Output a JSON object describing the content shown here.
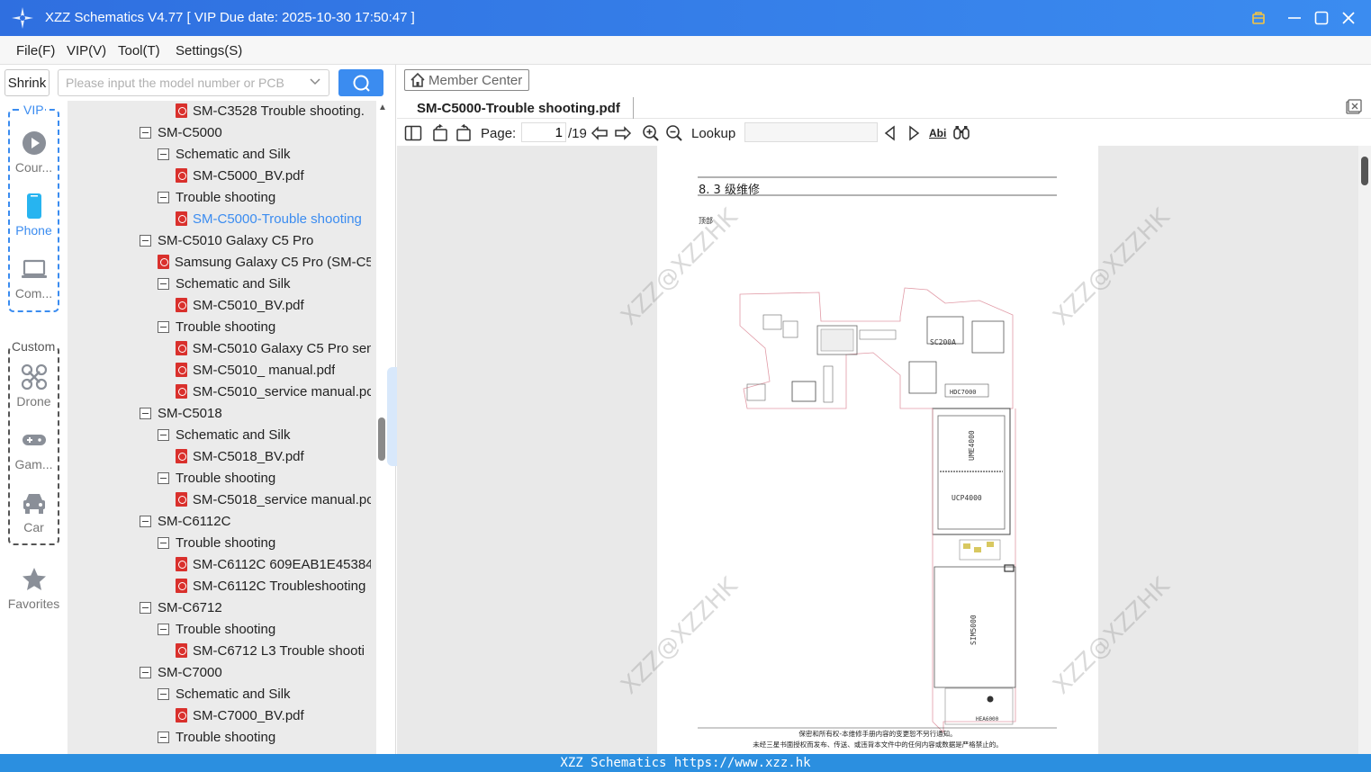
{
  "window": {
    "title": "XZZ Schematics V4.77 [ VIP Due date: 2025-10-30 17:50:47 ]",
    "accent": "#3b8cf0"
  },
  "menu": [
    "File(F)",
    "VIP(V)",
    "Tool(T)",
    "Settings(S)"
  ],
  "toolbar_left": {
    "shrink_label": "Shrink",
    "search_placeholder": "Please input the model number or PCB"
  },
  "categories": {
    "vip_label": "VIP",
    "custom_label": "Custom",
    "vip_items": [
      {
        "label": "Cour...",
        "icon": "play-circle-icon"
      },
      {
        "label": "Phone",
        "icon": "phone-icon"
      },
      {
        "label": "Com...",
        "icon": "laptop-icon"
      }
    ],
    "custom_items": [
      {
        "label": "Drone",
        "icon": "drone-icon"
      },
      {
        "label": "Gam...",
        "icon": "gamepad-icon"
      },
      {
        "label": "Car",
        "icon": "car-icon"
      }
    ],
    "favorites": {
      "label": "Favorites",
      "icon": "star-icon"
    }
  },
  "tree": [
    {
      "type": "pdf",
      "level": 2,
      "label": "SM-C3528 Trouble shooting."
    },
    {
      "type": "folder",
      "level": 0,
      "label": "SM-C5000"
    },
    {
      "type": "folder",
      "level": 1,
      "label": "Schematic and Silk"
    },
    {
      "type": "pdf",
      "level": 2,
      "label": "SM-C5000_BV.pdf"
    },
    {
      "type": "folder",
      "level": 1,
      "label": "Trouble shooting"
    },
    {
      "type": "pdf",
      "level": 2,
      "label": "SM-C5000-Trouble shooting",
      "selected": true
    },
    {
      "type": "folder",
      "level": 0,
      "label": "SM-C5010 Galaxy C5 Pro"
    },
    {
      "type": "pdf",
      "level": 1,
      "label": "Samsung Galaxy C5 Pro (SM-C5"
    },
    {
      "type": "folder",
      "level": 1,
      "label": "Schematic and Silk"
    },
    {
      "type": "pdf",
      "level": 2,
      "label": "SM-C5010_BV.pdf"
    },
    {
      "type": "folder",
      "level": 1,
      "label": "Trouble shooting"
    },
    {
      "type": "pdf",
      "level": 2,
      "label": "SM-C5010 Galaxy C5 Pro sen"
    },
    {
      "type": "pdf",
      "level": 2,
      "label": "SM-C5010_ manual.pdf"
    },
    {
      "type": "pdf",
      "level": 2,
      "label": "SM-C5010_service manual.pc"
    },
    {
      "type": "folder",
      "level": 0,
      "label": "SM-C5018"
    },
    {
      "type": "folder",
      "level": 1,
      "label": "Schematic and Silk"
    },
    {
      "type": "pdf",
      "level": 2,
      "label": "SM-C5018_BV.pdf"
    },
    {
      "type": "folder",
      "level": 1,
      "label": "Trouble shooting"
    },
    {
      "type": "pdf",
      "level": 2,
      "label": "SM-C5018_service manual.pc"
    },
    {
      "type": "folder",
      "level": 0,
      "label": "SM-C6112C"
    },
    {
      "type": "folder",
      "level": 1,
      "label": "Trouble shooting"
    },
    {
      "type": "pdf",
      "level": 2,
      "label": "SM-C6112C 609EAB1E45384"
    },
    {
      "type": "pdf",
      "level": 2,
      "label": "SM-C6112C Troubleshooting"
    },
    {
      "type": "folder",
      "level": 0,
      "label": "SM-C6712"
    },
    {
      "type": "folder",
      "level": 1,
      "label": "Trouble shooting"
    },
    {
      "type": "pdf",
      "level": 2,
      "label": "SM-C6712 L3 Trouble shooti"
    },
    {
      "type": "folder",
      "level": 0,
      "label": "SM-C7000"
    },
    {
      "type": "folder",
      "level": 1,
      "label": "Schematic and Silk"
    },
    {
      "type": "pdf",
      "level": 2,
      "label": "SM-C7000_BV.pdf"
    },
    {
      "type": "folder",
      "level": 1,
      "label": "Trouble shooting"
    }
  ],
  "viewer": {
    "member_center": "Member Center",
    "tab_title": "SM-C5000-Trouble shooting.pdf",
    "page_label": "Page:",
    "page_current": "1",
    "page_total": "/19",
    "lookup_label": "Lookup",
    "lookup_value": "",
    "abi_label": "Abi",
    "doc": {
      "heading": "8. 3 级维修",
      "subheading": "顶部",
      "labels": [
        "HDC7000",
        "UME4000",
        "UCP4000",
        "SIM5000",
        "HEA6000",
        "SC200A"
      ],
      "footer_line1": "保密和所有权-本维修手册内容的变更恕不另行通知。",
      "footer_line2": "未经三星书面授权而发布、传送、或违背本文件中的任何内容或数据是严格禁止的。"
    },
    "watermark": "XZZ@XZZHK"
  },
  "statusbar": "XZZ Schematics https://www.xzz.hk"
}
